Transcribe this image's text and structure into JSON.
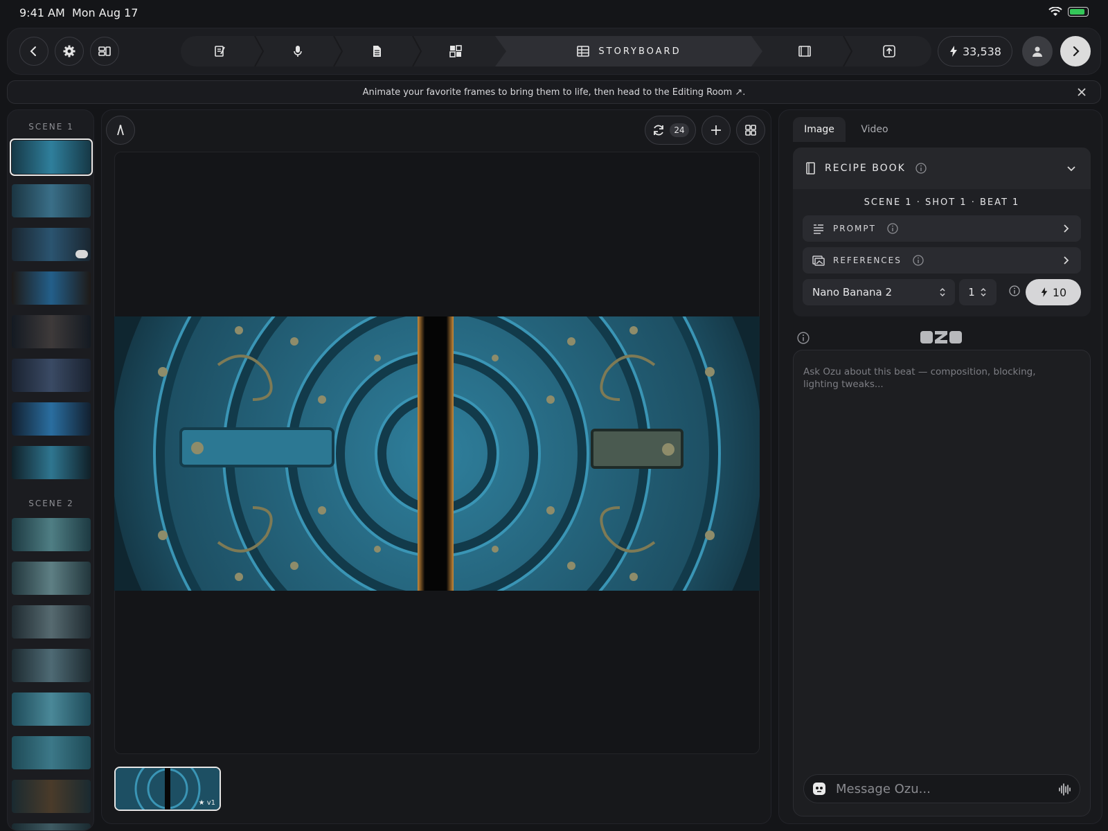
{
  "status": {
    "time": "9:41 AM",
    "date": "Mon Aug 17"
  },
  "toolbar": {
    "active_step_label": "STORYBOARD",
    "credits": "33,538",
    "steps": [
      "write-icon",
      "microphone-icon",
      "document-icon",
      "character-icon",
      "storyboard-icon",
      "film-strip-icon",
      "export-icon"
    ]
  },
  "banner": {
    "text": "Animate your favorite frames to bring them to life, then head to the Editing Room ↗."
  },
  "sidebar": {
    "scene1_label": "SCENE 1",
    "scene2_label": "SCENE 2"
  },
  "canvas": {
    "regen_count": "24",
    "version_label": "v1"
  },
  "panel": {
    "tabs": [
      "Image",
      "Video"
    ],
    "recipe_title": "RECIPE BOOK",
    "breadcrumb": "SCENE 1 · SHOT 1 · BEAT 1",
    "prompt_label": "PROMPT",
    "references_label": "REFERENCES",
    "model": "Nano Banana 2",
    "count": "1",
    "cost": "10",
    "brand": "OZU",
    "chat_placeholder": "Ask Ozu about this beat — composition, blocking, lighting tweaks...",
    "message_placeholder": "Message Ozu..."
  },
  "colors": {
    "accent": "#2f8fbf",
    "battery": "#34c759",
    "bg": "#141518"
  }
}
